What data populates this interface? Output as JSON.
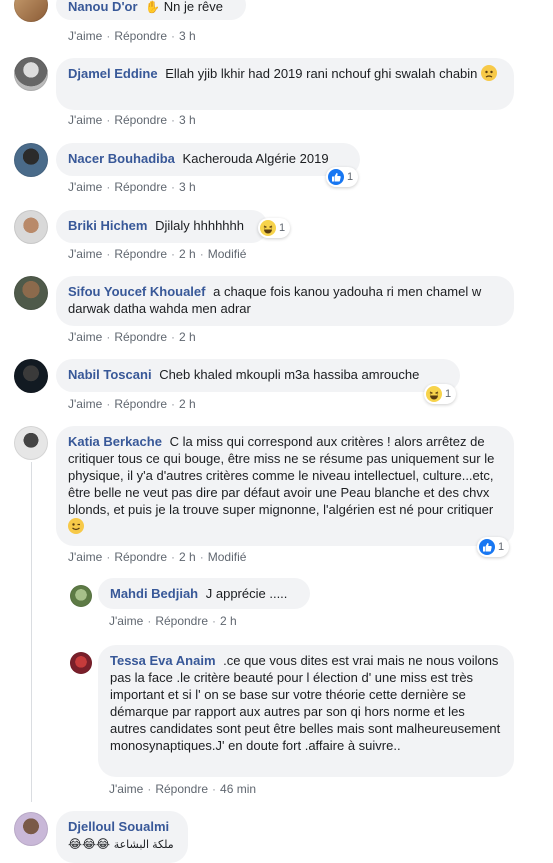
{
  "colors": {
    "name": "#385898",
    "bubble": "#f2f3f5",
    "meta": "#606770",
    "like": "#1877f2"
  },
  "actions": {
    "like": "J'aime",
    "reply": "Répondre",
    "modified": "Modifié"
  },
  "comments": [
    {
      "name": "Nanou D'or",
      "text": "Nn je rêve",
      "time": "3 h"
    },
    {
      "name": "Djamel Eddine",
      "text": "Ellah yjib lkhir had 2019 rani nchouf ghi swalah chabin",
      "time": "3 h"
    },
    {
      "name": "Nacer Bouhadiba",
      "text": "Kacherouda Algérie 2019",
      "time": "3 h",
      "reactions": "1"
    },
    {
      "name": "Briki Hichem",
      "text": "Djilaly hhhhhhh",
      "time": "2 h",
      "reactions": "1"
    },
    {
      "name": "Sifou Youcef Khoualef",
      "text": "a chaque fois kanou yadouha ri men chamel w darwak datha wahda men adrar",
      "time": "2 h"
    },
    {
      "name": "Nabil Toscani",
      "text": "Cheb khaled mkoupli m3a hassiba amrouche",
      "time": "2 h",
      "reactions": "1"
    },
    {
      "name": "Katia Berkache",
      "text": "C la miss qui correspond aux critères ! alors arrêtez de critiquer tous ce qui bouge, être miss ne se résume pas uniquement sur le physique, il y'a d'autres critères comme le niveau intellectuel, culture...etc, être belle ne veut pas dire par défaut avoir une Peau blanche et des chvx blonds, et puis je la trouve super mignonne, l'algérien est né pour critiquer",
      "time": "2 h",
      "reactions": "1"
    },
    {
      "name": "Mahdi Bedjiah",
      "text": "J apprécie .....",
      "time": "2 h"
    },
    {
      "name": "Tessa Eva Anaim",
      "text": ".ce que vous dites est vrai mais ne nous voilons pas la face .le critère beauté pour l élection d' une miss est très important et si l' on se base sur votre théorie cette dernière se démarque par rapport aux autres par son qi hors norme et les autres candidates sont peut être belles mais sont malheureusement monosynaptiques.J' en doute fort .affaire à suivre..",
      "time": "46 min"
    },
    {
      "name": "Djelloul Soualmi",
      "text": "ملكة البشاعة"
    }
  ]
}
